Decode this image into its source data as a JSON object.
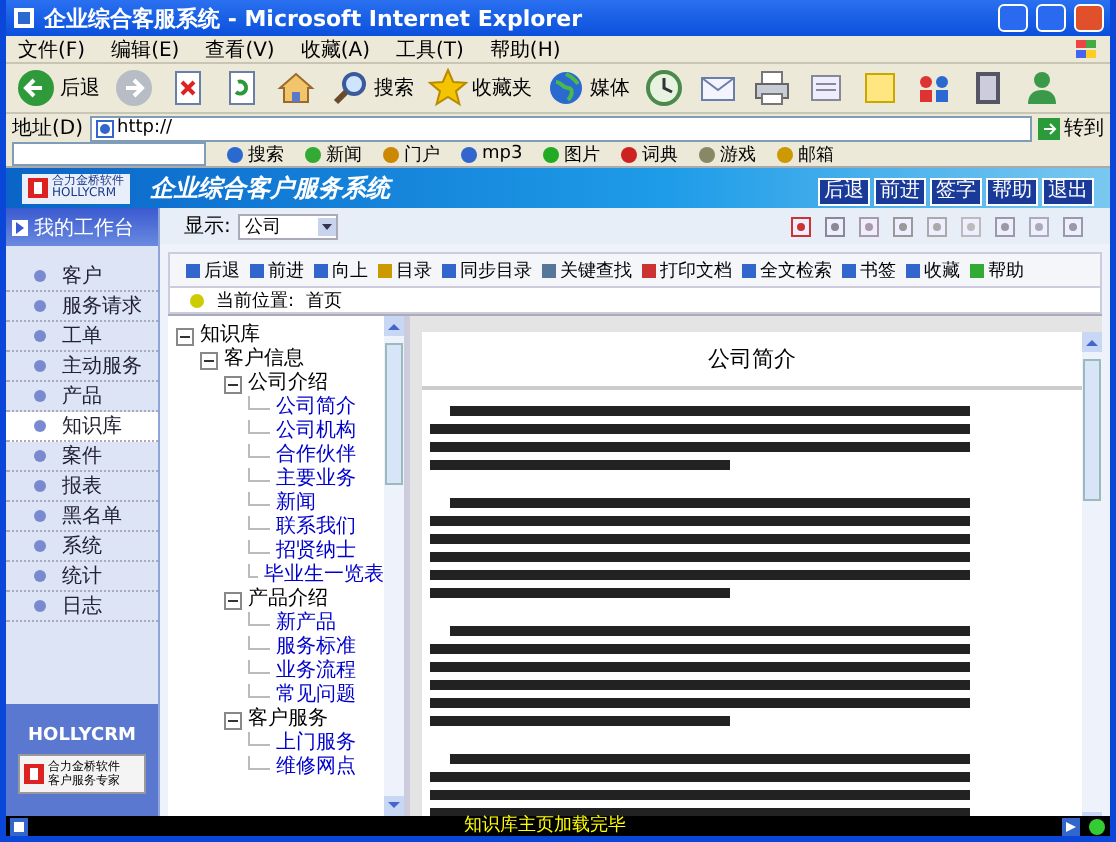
{
  "window": {
    "title": "企业综合客服系统 - Microsoft Internet Explorer"
  },
  "menu": [
    "文件(F)",
    "编辑(E)",
    "查看(V)",
    "收藏(A)",
    "工具(T)",
    "帮助(H)"
  ],
  "toolbar": [
    {
      "kind": "back",
      "label": "后退"
    },
    {
      "kind": "forward"
    },
    {
      "kind": "stop"
    },
    {
      "kind": "refresh"
    },
    {
      "kind": "home"
    },
    {
      "kind": "search",
      "label": "搜索"
    },
    {
      "kind": "favorites",
      "label": "收藏夹"
    },
    {
      "kind": "media",
      "label": "媒体"
    },
    {
      "kind": "history"
    },
    {
      "kind": "mail"
    },
    {
      "kind": "print"
    },
    {
      "kind": "edit"
    },
    {
      "kind": "note"
    },
    {
      "kind": "folder"
    },
    {
      "kind": "book"
    },
    {
      "kind": "messenger"
    }
  ],
  "address": {
    "label": "地址(D)",
    "value": "http://",
    "go": "转到"
  },
  "links": [
    "搜索",
    "新闻",
    "门户",
    "mp3",
    "图片",
    "词典",
    "游戏",
    "邮箱"
  ],
  "app": {
    "logo": "合力金桥软件",
    "logo_sub": "HOLLYCRM",
    "title": "企业综合客户服务系统",
    "header_buttons": [
      "后退",
      "前进",
      "签字",
      "帮助",
      "退出"
    ]
  },
  "sidebar": {
    "header": "我的工作台",
    "items": [
      {
        "label": "客户",
        "selected": false
      },
      {
        "label": "服务请求",
        "selected": false
      },
      {
        "label": "工单",
        "selected": false
      },
      {
        "label": "主动服务",
        "selected": false
      },
      {
        "label": "产品",
        "selected": false
      },
      {
        "label": "知识库",
        "selected": true
      },
      {
        "label": "案件",
        "selected": false
      },
      {
        "label": "报表",
        "selected": false
      },
      {
        "label": "黑名单",
        "selected": false
      },
      {
        "label": "系统",
        "selected": false
      },
      {
        "label": "统计",
        "selected": false
      },
      {
        "label": "日志",
        "selected": false
      }
    ],
    "footer_logo": "HOLLYCRM",
    "footer_badge": [
      "合力金桥软件",
      "客户服务专家"
    ]
  },
  "display": {
    "label": "显示:",
    "value": "公司"
  },
  "doc_toolbar": [
    "后退",
    "前进",
    "向上",
    "目录",
    "同步目录",
    "关键查找",
    "打印文档",
    "全文检索",
    "书签",
    "收藏",
    "帮助"
  ],
  "breadcrumb": {
    "label": "当前位置:",
    "value": "首页"
  },
  "tree": [
    {
      "kind": "folder",
      "label": "知识库",
      "expanded": true,
      "children": [
        {
          "kind": "folder",
          "label": "客户信息",
          "expanded": true,
          "children": [
            {
              "kind": "folder",
              "label": "公司介绍",
              "expanded": true,
              "children": [
                {
                  "kind": "page",
                  "label": "公司简介"
                },
                {
                  "kind": "page",
                  "label": "公司机构"
                },
                {
                  "kind": "page",
                  "label": "合作伙伴"
                },
                {
                  "kind": "page",
                  "label": "主要业务"
                },
                {
                  "kind": "page",
                  "label": "新闻"
                },
                {
                  "kind": "page",
                  "label": "联系我们"
                },
                {
                  "kind": "page",
                  "label": "招贤纳士"
                },
                {
                  "kind": "page",
                  "label": "毕业生一览表"
                }
              ]
            },
            {
              "kind": "folder",
              "label": "产品介绍",
              "expanded": true,
              "children": [
                {
                  "kind": "page",
                  "label": "新产品"
                },
                {
                  "kind": "page",
                  "label": "服务标准"
                },
                {
                  "kind": "page",
                  "label": "业务流程"
                },
                {
                  "kind": "page",
                  "label": "常见问题"
                }
              ]
            },
            {
              "kind": "folder",
              "label": "客户服务",
              "expanded": true,
              "children": [
                {
                  "kind": "page",
                  "label": "上门服务"
                },
                {
                  "kind": "page",
                  "label": "维修网点"
                }
              ]
            }
          ]
        }
      ]
    }
  ],
  "document": {
    "heading": "公司简介"
  },
  "status_bar": {
    "text": "知识库主页加载完毕"
  }
}
